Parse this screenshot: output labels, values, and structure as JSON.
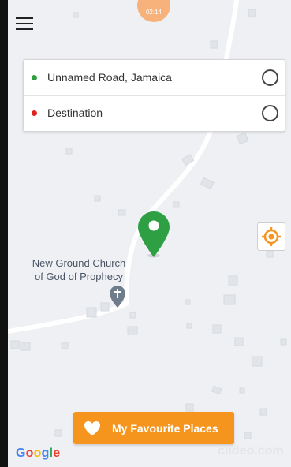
{
  "status": {
    "time": "02:14"
  },
  "route": {
    "origin": {
      "label": "Unnamed Road, Jamaica",
      "dot_color": "#2e9e3e"
    },
    "destination": {
      "label": "Destination",
      "dot_color": "#e0231c"
    }
  },
  "map": {
    "poi_label_line1": "New Ground Church",
    "poi_label_line2": "of God of Prophecy",
    "poi_icon": "church-pin-icon",
    "pin_color": "#2ea043"
  },
  "buttons": {
    "favourite_label": "My Favourite Places",
    "favourite_color": "#f6951e",
    "locate_icon": "crosshair-icon"
  },
  "branding": {
    "google": "Google",
    "watermark": "clideo.com"
  }
}
